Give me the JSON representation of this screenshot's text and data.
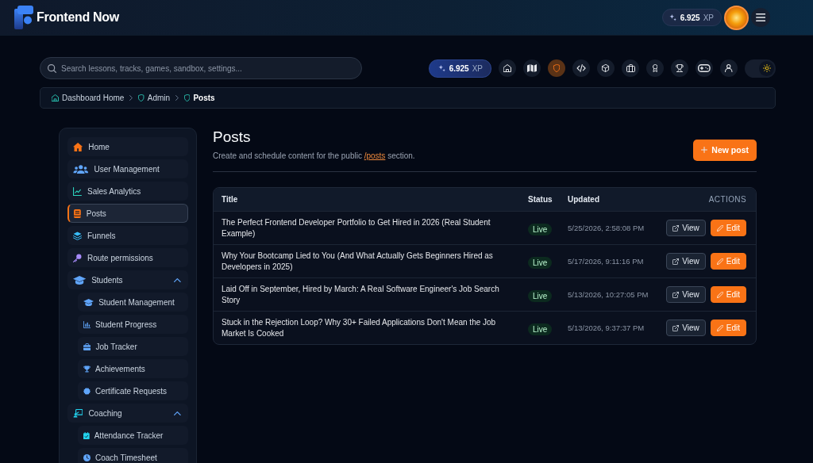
{
  "header": {
    "brand": "Frontend Now",
    "xp": {
      "value": "6.925",
      "unit": "XP"
    }
  },
  "toolbar": {
    "search": {
      "placeholder": "Search lessons, tracks, games, sandbox, settings..."
    },
    "xp": {
      "value": "6.925",
      "unit": "XP"
    },
    "buttons": [
      {
        "selected": false
      },
      {
        "selected": false
      },
      {
        "selected": true
      },
      {
        "selected": false
      },
      {
        "selected": false
      },
      {
        "selected": false
      },
      {
        "selected": false
      },
      {
        "selected": false
      },
      {
        "selected": false
      },
      {
        "selected": false
      }
    ],
    "theme_toggle": {
      "on": true
    }
  },
  "breadcrumb": {
    "items": [
      {
        "label": "Dashboard Home",
        "current": false
      },
      {
        "label": "Admin",
        "current": false
      },
      {
        "label": "Posts",
        "current": true
      }
    ]
  },
  "sidebar": {
    "items": [
      {
        "kind": "link",
        "label": "Home",
        "selected": false
      },
      {
        "kind": "link",
        "label": "User Management",
        "selected": false
      },
      {
        "kind": "link",
        "label": "Sales Analytics",
        "selected": false
      },
      {
        "kind": "link",
        "label": "Posts",
        "selected": true
      },
      {
        "kind": "link",
        "label": "Funnels",
        "selected": false
      },
      {
        "kind": "link",
        "label": "Route permissions",
        "selected": false
      },
      {
        "kind": "group",
        "label": "Students",
        "selected": false,
        "expanded": true,
        "children": [
          {
            "label": "Student Management",
            "selected": false
          },
          {
            "label": "Student Progress",
            "selected": false
          },
          {
            "label": "Job Tracker",
            "selected": false
          },
          {
            "label": "Achievements",
            "selected": false
          },
          {
            "label": "Certificate Requests",
            "selected": false
          }
        ]
      },
      {
        "kind": "group",
        "label": "Coaching",
        "selected": false,
        "expanded": true,
        "children": [
          {
            "label": "Attendance Tracker",
            "selected": false
          },
          {
            "label": "Coach Timesheet",
            "selected": false
          }
        ]
      }
    ]
  },
  "page": {
    "title": "Posts",
    "description": {
      "before": "Create and schedule content for the public",
      "link": "/posts",
      "after": "section."
    },
    "new_button": "New post"
  },
  "posts_table": {
    "columns": [
      "Title",
      "Status",
      "Updated",
      "ACTIONS"
    ],
    "rows": [
      {
        "title": "The Perfect Frontend Developer Portfolio to Get Hired in 2026 (Real Student Example)",
        "status": "Live",
        "updated": "5/25/2026, 2:58:08 PM",
        "actions": [
          {
            "kind": "view",
            "label": "View"
          },
          {
            "kind": "edit",
            "label": "Edit"
          }
        ]
      },
      {
        "title": "Why Your Bootcamp Lied to You (And What Actually Gets Beginners Hired as Developers in 2025)",
        "status": "Live",
        "updated": "5/17/2026, 9:11:16 PM",
        "actions": [
          {
            "kind": "view",
            "label": "View"
          },
          {
            "kind": "edit",
            "label": "Edit"
          }
        ]
      },
      {
        "title": "Laid Off in September, Hired by March: A Real Software Engineer's Job Search Story",
        "status": "Live",
        "updated": "5/13/2026, 10:27:05 PM",
        "actions": [
          {
            "kind": "view",
            "label": "View"
          },
          {
            "kind": "edit",
            "label": "Edit"
          }
        ]
      },
      {
        "title": "Stuck in the Rejection Loop? Why 30+ Failed Applications Don't Mean the Job Market Is Cooked",
        "status": "Live",
        "updated": "5/13/2026, 9:37:37 PM",
        "actions": [
          {
            "kind": "view",
            "label": "View"
          },
          {
            "kind": "edit",
            "label": "Edit"
          }
        ]
      }
    ]
  }
}
